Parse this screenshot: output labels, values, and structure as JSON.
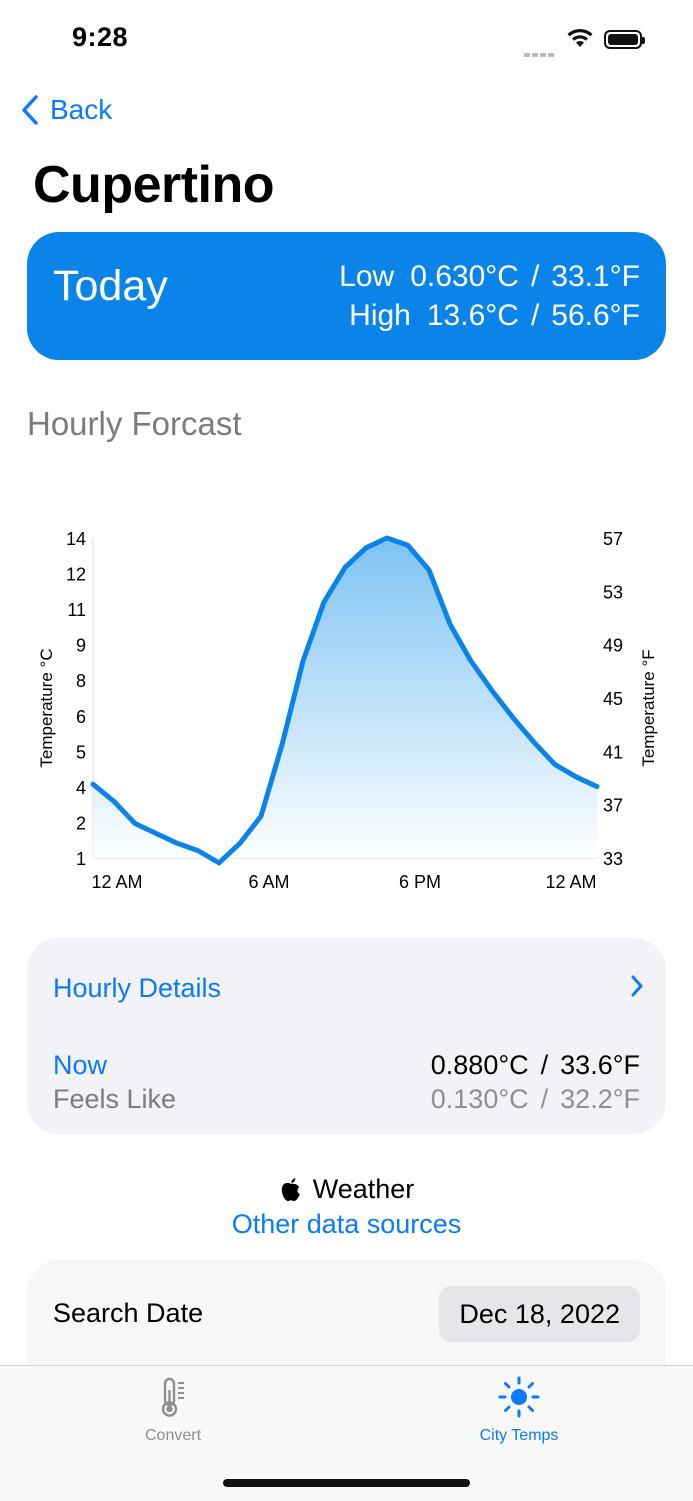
{
  "status": {
    "time": "9:28"
  },
  "nav": {
    "back_label": "Back",
    "title": "Cupertino"
  },
  "today": {
    "label": "Today",
    "low_label": "Low",
    "low_c": "0.630°C",
    "low_f": "33.1°F",
    "high_label": "High",
    "high_c": "13.6°C",
    "high_f": "56.6°F",
    "separator": "/"
  },
  "forecast": {
    "section_title": "Hourly Forcast"
  },
  "chart_data": {
    "type": "area",
    "x_ticks": [
      "12 AM",
      "6 AM",
      "6 PM",
      "12 AM"
    ],
    "y_left_label": "Temperature °C",
    "y_right_label": "Temperature °F",
    "y_left_ticks": [
      "14",
      "12",
      "11",
      "9",
      "8",
      "6",
      "5",
      "4",
      "2",
      "1"
    ],
    "y_right_ticks": [
      "57",
      "53",
      "49",
      "45",
      "41",
      "37",
      "33"
    ],
    "ylim_c": [
      1,
      14
    ],
    "x_hours": [
      0,
      1,
      2,
      3,
      4,
      5,
      6,
      7,
      8,
      9,
      10,
      11,
      12,
      13,
      14,
      15,
      16,
      17,
      18,
      19,
      20,
      21,
      22,
      23,
      24
    ],
    "values_c": [
      4.0,
      3.3,
      2.4,
      2.0,
      1.6,
      1.3,
      0.8,
      1.6,
      2.7,
      5.6,
      9.0,
      11.4,
      12.8,
      13.6,
      14.0,
      13.7,
      12.7,
      10.5,
      9.0,
      7.8,
      6.7,
      5.7,
      4.8,
      4.3,
      3.9
    ],
    "colors": {
      "line": "#0a84e8",
      "fill_top": "#7ec3f2",
      "fill_bottom": "#ffffff"
    }
  },
  "details": {
    "link_label": "Hourly Details",
    "now_label": "Now",
    "now_c": "0.880°C",
    "now_f": "33.6°F",
    "feels_label": "Feels Like",
    "feels_c": "0.130°C",
    "feels_f": "32.2°F",
    "separator": "/"
  },
  "attribution": {
    "brand": "Weather",
    "link": "Other data sources"
  },
  "search": {
    "label": "Search Date",
    "date": "Dec 18, 2022"
  },
  "tabs": [
    {
      "label": "Convert",
      "icon": "thermometer-icon",
      "active": false
    },
    {
      "label": "City Temps",
      "icon": "sun-icon",
      "active": true
    }
  ]
}
